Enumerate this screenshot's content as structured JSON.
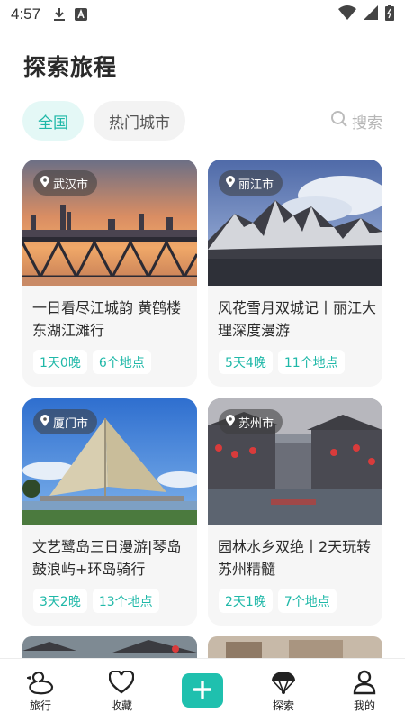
{
  "status_bar": {
    "time": "4:57"
  },
  "page_title": "探索旅程",
  "filters": {
    "all": "全国",
    "hot_cities": "热门城市",
    "search": "搜索"
  },
  "cards": [
    {
      "city": "武汉市",
      "title": "一日看尽江城韵 黄鹤楼东湖江滩行",
      "days": "1天0晚",
      "places": "6个地点"
    },
    {
      "city": "丽江市",
      "title": "风花雪月双城记丨丽江大理深度漫游",
      "days": "5天4晚",
      "places": "11个地点"
    },
    {
      "city": "厦门市",
      "title": "文艺鹭岛三日漫游|琴岛鼓浪屿+环岛骑行",
      "days": "3天2晚",
      "places": "13个地点"
    },
    {
      "city": "苏州市",
      "title": "园林水乡双绝丨2天玩转苏州精髓",
      "days": "2天1晚",
      "places": "7个地点"
    }
  ],
  "bottom_nav": {
    "travel": "旅行",
    "favorites": "收藏",
    "explore": "探索",
    "mine": "我的"
  },
  "colors": {
    "accent": "#1fb8a8",
    "chip_active_bg": "#e4f8f6",
    "card_bg": "#f6f6f6"
  }
}
